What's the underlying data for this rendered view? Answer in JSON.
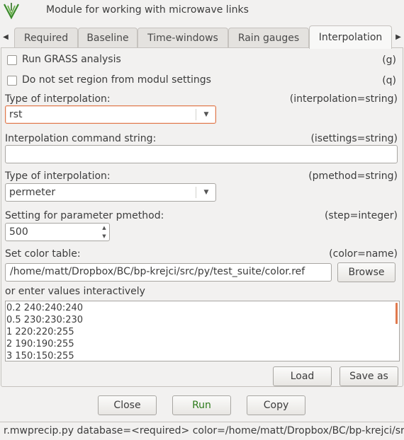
{
  "window": {
    "title": "Module for working with microwave links"
  },
  "tabs": [
    {
      "label": "Required"
    },
    {
      "label": "Baseline"
    },
    {
      "label": "Time-windows"
    },
    {
      "label": "Rain gauges"
    },
    {
      "label": "Interpolation"
    }
  ],
  "form": {
    "run_grass": {
      "label": "Run GRASS analysis",
      "key": "(g)",
      "checked": false
    },
    "no_region": {
      "label": "Do not set region from modul settings",
      "key": "(q)",
      "checked": false
    },
    "interpolation_type": {
      "label": "Type of interpolation:",
      "key": "(interpolation=string)",
      "value": "rst"
    },
    "isettings": {
      "label": "Interpolation command string:",
      "key": "(isettings=string)",
      "value": ""
    },
    "pmethod": {
      "label": "Type of interpolation:",
      "key": "(pmethod=string)",
      "value": "permeter"
    },
    "step": {
      "label": "Setting for parameter pmethod:",
      "key": "(step=integer)",
      "value": "500"
    },
    "color": {
      "label": "Set color table:",
      "key": "(color=name)",
      "path": "/home/matt/Dropbox/BC/bp-krejci/src/py/test_suite/color.ref",
      "browse_label": "Browse"
    },
    "interactive": {
      "label": "or enter values interactively",
      "lines": [
        "0.2 240:240:240",
        "0.5 230:230:230",
        "1 220:220:255",
        "2 190:190:255",
        "3 150:150:255"
      ],
      "load_label": "Load",
      "save_label": "Save as"
    }
  },
  "buttons": {
    "close": "Close",
    "run": "Run",
    "copy": "Copy"
  },
  "status": {
    "command": "r.mwprecip.py database=<required> color=/home/matt/Dropbox/BC/bp-krejci/src/py"
  },
  "colors": {
    "accent": "#e07a4e",
    "run_text": "#2c7a1a",
    "background": "#f2f1f0"
  },
  "icons": {
    "app": "grass-logo-icon",
    "left": "chevron-left-icon",
    "right": "chevron-right-icon",
    "dropdown": "chevron-down-icon"
  }
}
